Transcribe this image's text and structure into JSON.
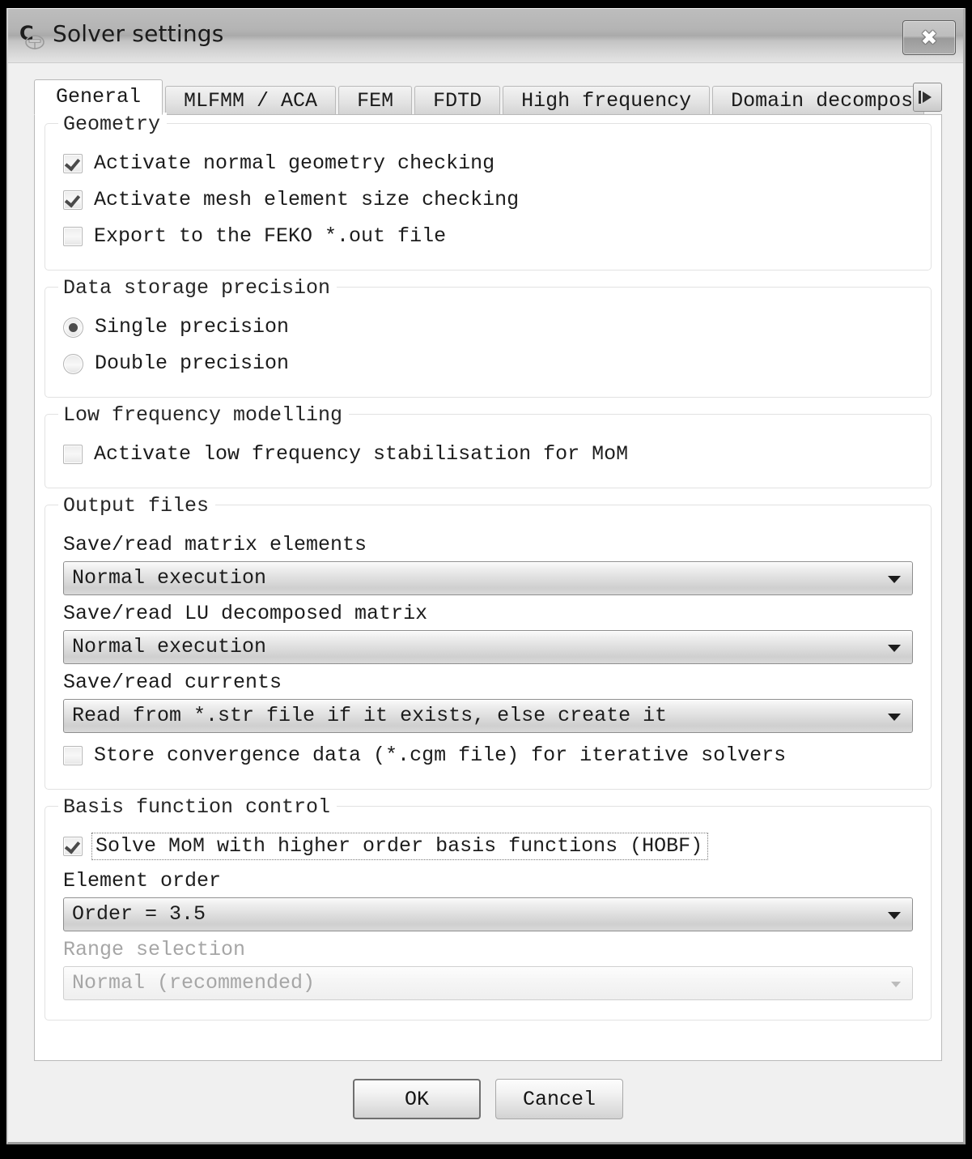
{
  "window": {
    "title": "Solver settings",
    "icon": "solver-app-icon",
    "close_label": "✖"
  },
  "tabs": [
    {
      "label": "General",
      "active": true
    },
    {
      "label": "MLFMM / ACA",
      "active": false
    },
    {
      "label": "FEM",
      "active": false
    },
    {
      "label": "FDTD",
      "active": false
    },
    {
      "label": "High frequency",
      "active": false
    },
    {
      "label": "Domain decomposition",
      "active": false
    }
  ],
  "tab_scroll": {
    "icon": "scroll-right-icon"
  },
  "groups": {
    "geometry": {
      "legend": "Geometry",
      "checkboxes": [
        {
          "label": "Activate normal geometry checking",
          "checked": true
        },
        {
          "label": "Activate mesh element size checking",
          "checked": true
        },
        {
          "label": "Export to the FEKO *.out file",
          "checked": false
        }
      ]
    },
    "precision": {
      "legend": "Data storage precision",
      "radios": [
        {
          "label": "Single precision",
          "checked": true
        },
        {
          "label": "Double precision",
          "checked": false
        }
      ]
    },
    "low_frequency": {
      "legend": "Low frequency modelling",
      "checkboxes": [
        {
          "label": "Activate low frequency stabilisation for MoM",
          "checked": false
        }
      ]
    },
    "output_files": {
      "legend": "Output files",
      "fields": [
        {
          "label": "Save/read matrix elements",
          "value": "Normal execution"
        },
        {
          "label": "Save/read LU decomposed matrix",
          "value": "Normal execution"
        },
        {
          "label": "Save/read currents",
          "value": "Read from *.str file if it exists, else create it"
        }
      ],
      "checkboxes": [
        {
          "label": "Store convergence data (*.cgm file) for iterative solvers",
          "checked": false
        }
      ]
    },
    "basis_function": {
      "legend": "Basis function control",
      "hobf": {
        "label": "Solve MoM with higher order basis functions (HOBF)",
        "checked": true,
        "focused": true
      },
      "element_order": {
        "label": "Element order",
        "value": "Order = 3.5",
        "disabled": false
      },
      "range_selection": {
        "label": "Range selection",
        "value": "Normal (recommended)",
        "disabled": true
      }
    }
  },
  "footer": {
    "ok_label": "OK",
    "cancel_label": "Cancel"
  },
  "colors": {
    "titlebar": "#b4b4b4",
    "dialog_bg": "#f0f0f0",
    "page_bg": "#ffffff",
    "group_border": "#e2e2e2",
    "text": "#1c1c1c",
    "disabled_text": "#a6a6a6"
  }
}
